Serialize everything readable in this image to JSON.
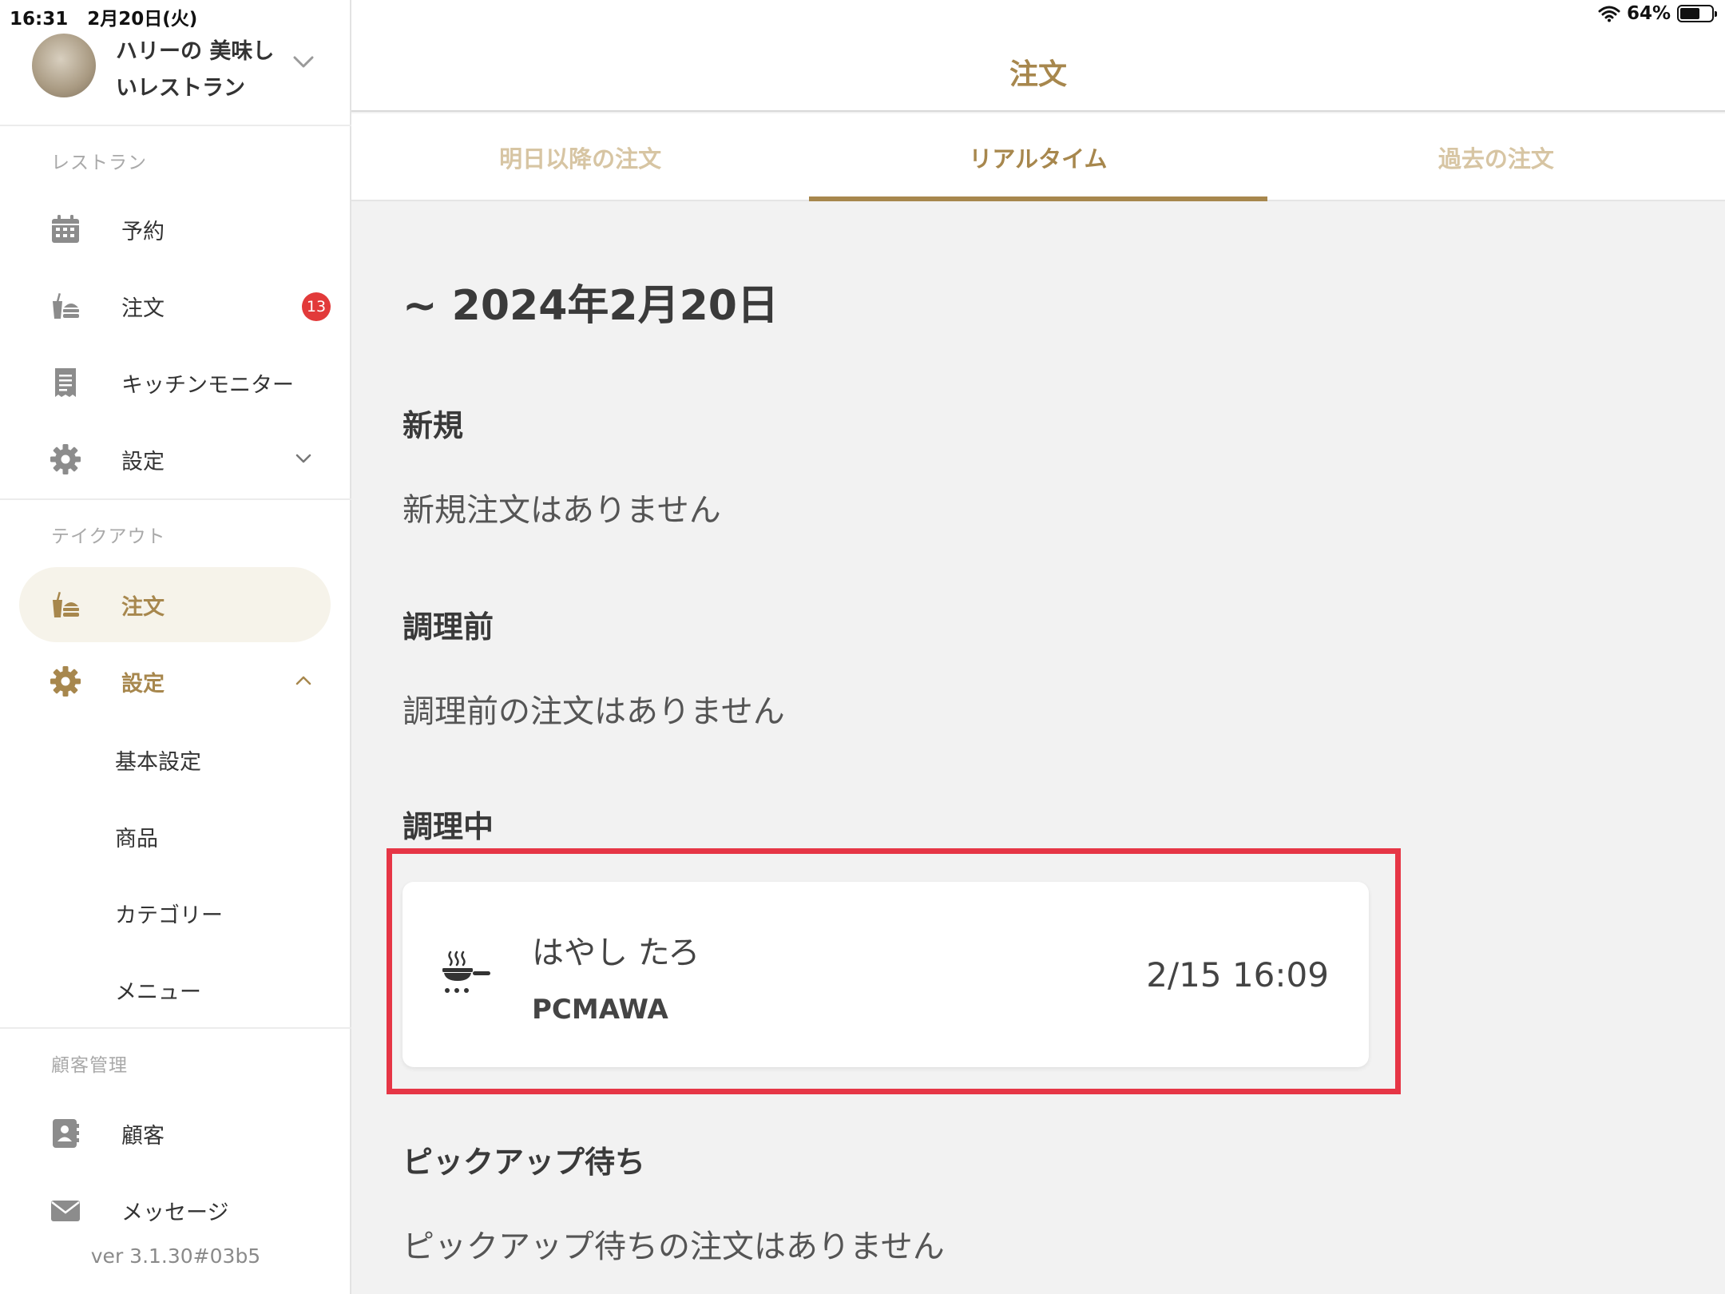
{
  "status_bar": {
    "time": "16:31",
    "date": "2月20日(火)",
    "battery": "64%"
  },
  "account": {
    "name": "ハリーの 美味しいレストラン"
  },
  "sidebar": {
    "restaurant_label": "レストラン",
    "restaurant_items": [
      {
        "label": "予約",
        "icon": "calendar-icon"
      },
      {
        "label": "注文",
        "icon": "takeout-icon",
        "badge": "13"
      },
      {
        "label": "キッチンモニター",
        "icon": "receipt-icon"
      },
      {
        "label": "設定",
        "icon": "gear-icon"
      }
    ],
    "takeout_label": "テイクアウト",
    "takeout_items": [
      {
        "label": "注文",
        "icon": "takeout-icon"
      },
      {
        "label": "設定",
        "icon": "gear-icon"
      }
    ],
    "settings_sub": [
      "基本設定",
      "商品",
      "カテゴリー",
      "メニュー"
    ],
    "customer_label": "顧客管理",
    "customer_items": [
      {
        "label": "顧客",
        "icon": "contact-icon"
      },
      {
        "label": "メッセージ",
        "icon": "mail-icon"
      }
    ],
    "version": "ver 3.1.30#03b5"
  },
  "header": {
    "title": "注文"
  },
  "tabs": [
    {
      "label": "明日以降の注文",
      "active": false
    },
    {
      "label": "リアルタイム",
      "active": true
    },
    {
      "label": "過去の注文",
      "active": false
    }
  ],
  "main": {
    "date_heading": "~ 2024年2月20日",
    "groups": {
      "new": {
        "title": "新規",
        "empty": "新規注文はありません"
      },
      "before_cooking": {
        "title": "調理前",
        "empty": "調理前の注文はありません"
      },
      "cooking": {
        "title": "調理中"
      },
      "waiting_pickup": {
        "title": "ピックアップ待ち",
        "empty": "ピックアップ待ちの注文はありません"
      }
    },
    "order": {
      "name": "はやし たろ",
      "code": "PCMAWA",
      "time": "2/15 16:09",
      "icon": "cooking-pan-icon"
    }
  },
  "colors": {
    "accent": "#a7874d",
    "highlight": "#e63646",
    "badge": "#e23a3a"
  }
}
